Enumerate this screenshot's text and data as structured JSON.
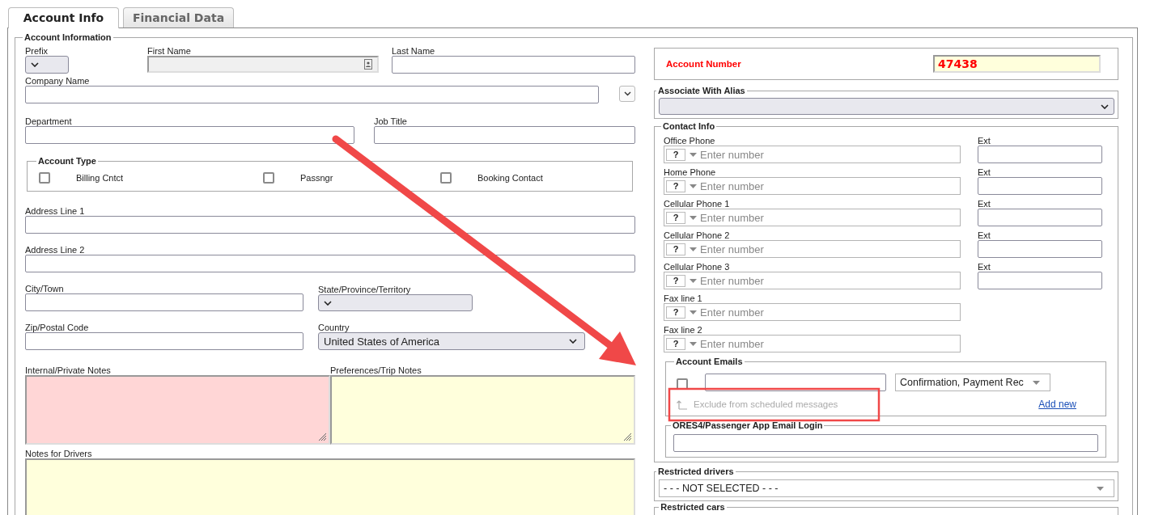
{
  "tabs": [
    {
      "label": "Account Info",
      "selected": true
    },
    {
      "label": "Financial Data",
      "selected": false
    }
  ],
  "account_information": {
    "legend": "Account Information",
    "prefix": {
      "label": "Prefix"
    },
    "first_name": {
      "label": "First Name"
    },
    "last_name": {
      "label": "Last Name"
    },
    "company_name": {
      "label": "Company Name"
    },
    "department": {
      "label": "Department"
    },
    "job_title": {
      "label": "Job Title"
    },
    "account_type": {
      "legend": "Account Type",
      "options": [
        {
          "label": "Billing Cntct",
          "checked": false
        },
        {
          "label": "Passngr",
          "checked": false
        },
        {
          "label": "Booking Contact",
          "checked": false
        }
      ]
    },
    "address_line_1": {
      "label": "Address Line 1"
    },
    "address_line_2": {
      "label": "Address Line 2"
    },
    "city": {
      "label": "City/Town"
    },
    "state": {
      "label": "State/Province/Territory"
    },
    "zip": {
      "label": "Zip/Postal Code"
    },
    "country": {
      "label": "Country",
      "value": "United States of America"
    },
    "internal_notes": {
      "label": "Internal/Private Notes"
    },
    "trip_notes": {
      "label": "Preferences/Trip Notes"
    },
    "driver_notes": {
      "label": "Notes for Drivers"
    }
  },
  "account_number": {
    "label": "Account Number",
    "value": "47438"
  },
  "associate_with_alias": {
    "legend": "Associate With Alias"
  },
  "contact_info": {
    "legend": "Contact Info",
    "phones": [
      {
        "label": "Office Phone",
        "country_code": "?",
        "placeholder": "Enter number",
        "ext_label": "Ext"
      },
      {
        "label": "Home Phone",
        "country_code": "?",
        "placeholder": "Enter number",
        "ext_label": "Ext"
      },
      {
        "label": "Cellular Phone 1",
        "country_code": "?",
        "placeholder": "Enter number",
        "ext_label": "Ext"
      },
      {
        "label": "Cellular Phone 2",
        "country_code": "?",
        "placeholder": "Enter number",
        "ext_label": "Ext"
      },
      {
        "label": "Cellular Phone 3",
        "country_code": "?",
        "placeholder": "Enter number",
        "ext_label": "Ext"
      },
      {
        "label": "Fax line 1",
        "country_code": "?",
        "placeholder": "Enter number"
      },
      {
        "label": "Fax line 2",
        "country_code": "?",
        "placeholder": "Enter number"
      }
    ]
  },
  "account_emails": {
    "legend": "Account Emails",
    "rows": [
      {
        "checked": false,
        "message_types": "Confirmation, Payment Rec"
      }
    ],
    "exclude": {
      "label": "Exclude from scheduled messages",
      "disabled": true
    },
    "add_new": "Add new"
  },
  "app_login": {
    "legend": "ORES4/Passenger App Email Login"
  },
  "restricted_drivers": {
    "legend": "Restricted drivers",
    "value": "- - - NOT SELECTED - - -"
  },
  "restricted_cars": {
    "legend": "Restricted cars"
  }
}
